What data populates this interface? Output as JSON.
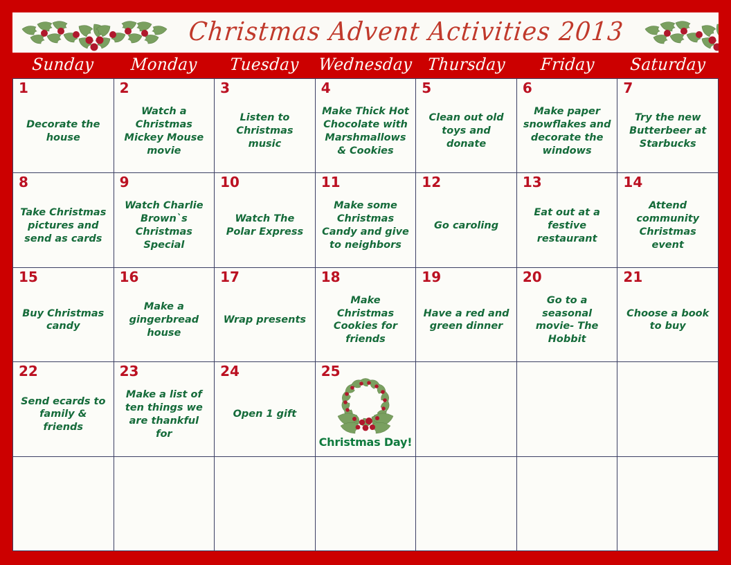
{
  "header": {
    "title": "Christmas  Advent  Activities  2013",
    "left_decoration": "holly-spray-icon",
    "right_decoration": "holly-spray-icon"
  },
  "colors": {
    "frame_red": "#cc0000",
    "title_red": "#c0392b",
    "number_red": "#bb1122",
    "activity_green": "#156b3a",
    "grid_line": "#3b3f63",
    "cell_background": "#fcfcf8",
    "header_text": "#fdfcf8",
    "holly_leaf_green": "#7aa060",
    "holly_berry_red": "#b0182c"
  },
  "weekdays": [
    "Sunday",
    "Monday",
    "Tuesday",
    "Wednesday",
    "Thursday",
    "Friday",
    "Saturday"
  ],
  "cells": [
    {
      "number": "1",
      "activity": "Decorate the house"
    },
    {
      "number": "2",
      "activity": "Watch a Christmas Mickey Mouse movie"
    },
    {
      "number": "3",
      "activity": "Listen to Christmas music"
    },
    {
      "number": "4",
      "activity": "Make Thick Hot Chocolate with Marshmallows & Cookies"
    },
    {
      "number": "5",
      "activity": "Clean out old toys and donate"
    },
    {
      "number": "6",
      "activity": "Make paper snowflakes and decorate the windows"
    },
    {
      "number": "7",
      "activity": "Try the new Butterbeer at Starbucks"
    },
    {
      "number": "8",
      "activity": "Take Christmas pictures and send as cards"
    },
    {
      "number": "9",
      "activity": "Watch Charlie Brown`s Christmas Special"
    },
    {
      "number": "10",
      "activity": "Watch The Polar Express"
    },
    {
      "number": "11",
      "activity": "Make some Christmas Candy and give to neighbors"
    },
    {
      "number": "12",
      "activity": "Go caroling"
    },
    {
      "number": "13",
      "activity": "Eat out at a festive restaurant"
    },
    {
      "number": "14",
      "activity": "Attend community Christmas event"
    },
    {
      "number": "15",
      "activity": "Buy Christmas candy"
    },
    {
      "number": "16",
      "activity": "Make a gingerbread house"
    },
    {
      "number": "17",
      "activity": "Wrap presents"
    },
    {
      "number": "18",
      "activity": "Make Christmas Cookies for friends"
    },
    {
      "number": "19",
      "activity": "Have a red and green dinner"
    },
    {
      "number": "20",
      "activity": "Go to a seasonal movie- The Hobbit"
    },
    {
      "number": "21",
      "activity": "Choose a book to buy"
    },
    {
      "number": "22",
      "activity": "Send ecards to family & friends"
    },
    {
      "number": "23",
      "activity": "Make a list of ten things we are thankful for"
    },
    {
      "number": "24",
      "activity": "Open 1 gift"
    },
    {
      "number": "25",
      "activity": "",
      "special_label": "Christmas Day!",
      "decoration": "holly-wreath-icon"
    },
    {
      "number": "",
      "activity": ""
    },
    {
      "number": "",
      "activity": ""
    },
    {
      "number": "",
      "activity": ""
    },
    {
      "number": "",
      "activity": ""
    },
    {
      "number": "",
      "activity": ""
    },
    {
      "number": "",
      "activity": ""
    },
    {
      "number": "",
      "activity": ""
    },
    {
      "number": "",
      "activity": ""
    },
    {
      "number": "",
      "activity": ""
    },
    {
      "number": "",
      "activity": ""
    }
  ]
}
